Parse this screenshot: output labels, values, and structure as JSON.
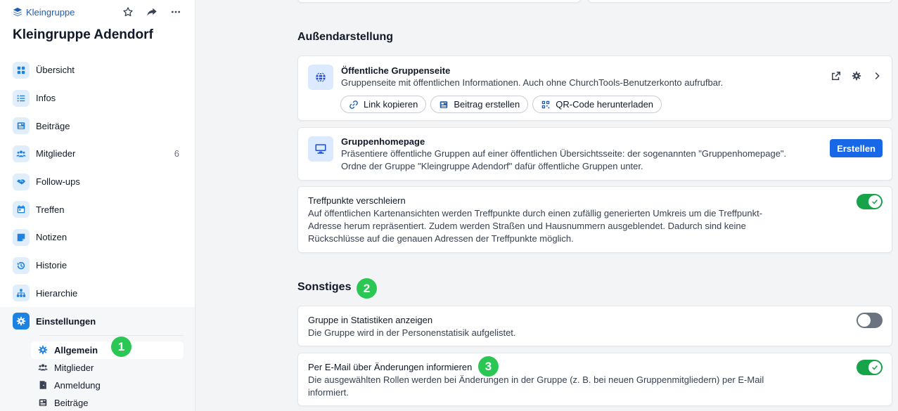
{
  "sidebar": {
    "crumb": "Kleingruppe",
    "group_title": "Kleingruppe Adendorf",
    "items": [
      {
        "label": "Übersicht",
        "icon": "grid-icon"
      },
      {
        "label": "Infos",
        "icon": "list-icon"
      },
      {
        "label": "Beiträge",
        "icon": "newspaper-icon"
      },
      {
        "label": "Mitglieder",
        "icon": "users-icon",
        "count": "6"
      },
      {
        "label": "Follow-ups",
        "icon": "handshake-icon"
      },
      {
        "label": "Treffen",
        "icon": "calendar-icon"
      },
      {
        "label": "Notizen",
        "icon": "note-icon"
      },
      {
        "label": "Historie",
        "icon": "history-icon"
      },
      {
        "label": "Hierarchie",
        "icon": "sitemap-icon"
      },
      {
        "label": "Einstellungen",
        "icon": "gear-icon"
      }
    ],
    "subitems": [
      {
        "label": "Allgemein",
        "icon": "gear-icon"
      },
      {
        "label": "Mitglieder",
        "icon": "users-icon"
      },
      {
        "label": "Anmeldung",
        "icon": "door-icon"
      },
      {
        "label": "Beiträge",
        "icon": "newspaper-icon"
      }
    ]
  },
  "badges": {
    "one": "1",
    "two": "2",
    "three": "3"
  },
  "sections": {
    "external": "Außendarstellung",
    "other": "Sonstiges"
  },
  "public_page": {
    "title": "Öffentliche Gruppenseite",
    "desc": "Gruppenseite mit öffentlichen Informationen. Auch ohne ChurchTools-Benutzerkonto aufrufbar.",
    "buttons": {
      "copy": "Link kopieren",
      "post": "Beitrag erstellen",
      "qr": "QR-Code herunterladen"
    }
  },
  "homepage": {
    "title": "Gruppenhomepage",
    "desc1": "Präsentiere öffentliche Gruppen auf einer öffentlichen Übersichtsseite: der sogenannten \"Gruppenhomepage\".",
    "desc2": "Ordne der Gruppe \"Kleingruppe Adendorf\" dafür öffentliche Gruppen unter.",
    "create": "Erstellen"
  },
  "obscure": {
    "title": "Treffpunkte verschleiern",
    "desc1": "Auf öffentlichen Kartenansichten werden Treffpunkte durch einen zufällig generierten Umkreis um die Treffpunkt-",
    "desc2": "Adresse herum repräsentiert. Zudem werden Straßen und Hausnummern ausgeblendet. Dadurch sind keine",
    "desc3": "Rückschlüsse auf die genauen Adressen der Treffpunkte möglich.",
    "enabled": true
  },
  "statistics": {
    "title": "Gruppe in Statistiken anzeigen",
    "desc": "Die Gruppe wird in der Personenstatisik aufgelistet.",
    "enabled": false
  },
  "email_notify": {
    "title": "Per E-Mail über Änderungen informieren",
    "desc1": "Die ausgewählten Rollen werden bei Änderungen in der Gruppe (z. B. bei neuen Gruppenmitgliedern) per E-Mail",
    "desc2": "informiert.",
    "enabled": true
  },
  "colors": {
    "accent": "#1767e6",
    "toggle_on": "#16a34a",
    "badge": "#2bc754",
    "link": "#1e5eb0"
  }
}
